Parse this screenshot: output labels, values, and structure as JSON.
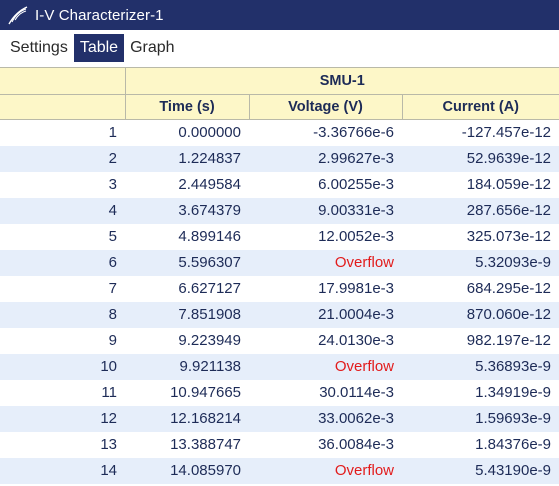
{
  "window": {
    "title": "I-V Characterizer-1",
    "logo_icon": "feather-logo"
  },
  "tabs": [
    {
      "label": "Settings",
      "active": false
    },
    {
      "label": "Table",
      "active": true
    },
    {
      "label": "Graph",
      "active": false
    }
  ],
  "table": {
    "group_header": "SMU-1",
    "columns": [
      "Time (s)",
      "Voltage (V)",
      "Current (A)"
    ],
    "rows": [
      [
        "1",
        "0.000000",
        "-3.36766e-6",
        "-127.457e-12"
      ],
      [
        "2",
        "1.224837",
        "2.99627e-3",
        "52.9639e-12"
      ],
      [
        "3",
        "2.449584",
        "6.00255e-3",
        "184.059e-12"
      ],
      [
        "4",
        "3.674379",
        "9.00331e-3",
        "287.656e-12"
      ],
      [
        "5",
        "4.899146",
        "12.0052e-3",
        "325.073e-12"
      ],
      [
        "6",
        "5.596307",
        "Overflow",
        "5.32093e-9"
      ],
      [
        "7",
        "6.627127",
        "17.9981e-3",
        "684.295e-12"
      ],
      [
        "8",
        "7.851908",
        "21.0004e-3",
        "870.060e-12"
      ],
      [
        "9",
        "9.223949",
        "24.0130e-3",
        "982.197e-12"
      ],
      [
        "10",
        "9.921138",
        "Overflow",
        "5.36893e-9"
      ],
      [
        "11",
        "10.947665",
        "30.0114e-3",
        "1.34919e-9"
      ],
      [
        "12",
        "12.168214",
        "33.0062e-3",
        "1.59693e-9"
      ],
      [
        "13",
        "13.388747",
        "36.0084e-3",
        "1.84376e-9"
      ],
      [
        "14",
        "14.085970",
        "Overflow",
        "5.43190e-9"
      ]
    ]
  },
  "colors": {
    "titlebar": "#22306a",
    "header_bg": "#fdf7c8",
    "row_alt": "#e6eefa",
    "overflow_text": "#e21b1b"
  }
}
